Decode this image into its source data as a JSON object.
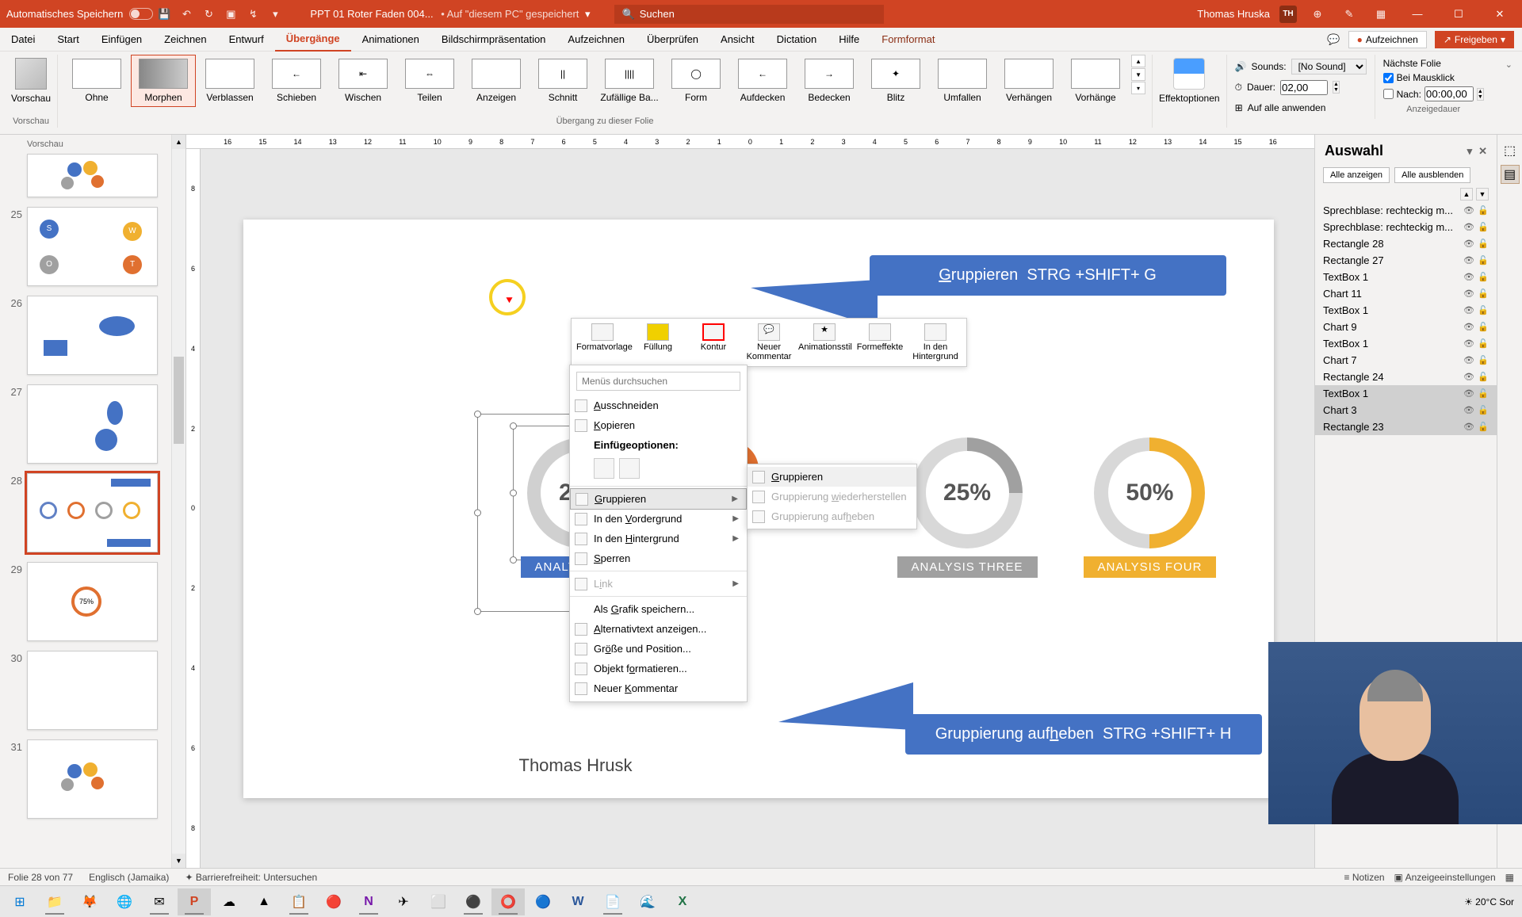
{
  "titlebar": {
    "autosave": "Automatisches Speichern",
    "doc_name": "PPT 01 Roter Faden 004...",
    "doc_location": "• Auf \"diesem PC\" gespeichert",
    "search_placeholder": "Suchen",
    "user_name": "Thomas Hruska",
    "user_initials": "TH"
  },
  "menubar": {
    "tabs": [
      "Datei",
      "Start",
      "Einfügen",
      "Zeichnen",
      "Entwurf",
      "Übergänge",
      "Animationen",
      "Bildschirmpräsentation",
      "Aufzeichnen",
      "Überprüfen",
      "Ansicht",
      "Dictation",
      "Hilfe",
      "Formformat"
    ],
    "active_index": 5,
    "record": "Aufzeichnen",
    "share": "Freigeben"
  },
  "ribbon": {
    "preview": "Vorschau",
    "transitions": [
      "Ohne",
      "Morphen",
      "Verblassen",
      "Schieben",
      "Wischen",
      "Teilen",
      "Anzeigen",
      "Schnitt",
      "Zufällige Ba...",
      "Form",
      "Aufdecken",
      "Bedecken",
      "Blitz",
      "Umfallen",
      "Verhängen",
      "Vorhänge"
    ],
    "selected_index": 1,
    "group_transition": "Übergang zu dieser Folie",
    "effect_options": "Effektoptionen",
    "sounds_label": "Sounds:",
    "sounds_value": "[No Sound]",
    "duration_label": "Dauer:",
    "duration_value": "02,00",
    "apply_all": "Auf alle anwenden",
    "next_slide": "Nächste Folie",
    "on_click": "Bei Mausklick",
    "after": "Nach:",
    "after_value": "00:00,00",
    "group_timing": "Anzeigedauer"
  },
  "thumbnails": {
    "preview_label": "Vorschau",
    "items": [
      {
        "num": "",
        "current": false
      },
      {
        "num": "25",
        "current": false
      },
      {
        "num": "26",
        "current": false
      },
      {
        "num": "27",
        "current": false
      },
      {
        "num": "28",
        "current": true
      },
      {
        "num": "29",
        "current": false
      },
      {
        "num": "30",
        "current": false
      },
      {
        "num": "31",
        "current": false
      }
    ]
  },
  "slide": {
    "callout_top": "Gruppieren  STRG +SHIFT+ G",
    "callout_top_u": "G",
    "callout_bottom": "Gruppierung aufheben  STRG +SHIFT+ H",
    "callout_bottom_u": "h",
    "donut1_val": "20%",
    "donut1_label": "ANALYSIS ONE",
    "donut3_val": "25%",
    "donut3_label": "ANALYSIS THREE",
    "donut4_val": "50%",
    "donut4_label": "ANALYSIS FOUR",
    "presenter": "Thomas Hrusk"
  },
  "mini_toolbar": [
    "Formatvorlage",
    "Füllung",
    "Kontur",
    "Neuer Kommentar",
    "Animationsstil",
    "Formeffekte",
    "In den Hintergrund"
  ],
  "context_menu": {
    "search_ph": "Menüs durchsuchen",
    "items": [
      {
        "label": "Ausschneiden",
        "u": "A",
        "icon": true
      },
      {
        "label": "Kopieren",
        "u": "K",
        "icon": true
      }
    ],
    "paste_label": "Einfügeoptionen:",
    "items2": [
      {
        "label": "Gruppieren",
        "u": "G",
        "arrow": true,
        "highlighted": true,
        "icon": true
      },
      {
        "label": "In den Vordergrund",
        "u": "V",
        "arrow": true,
        "icon": true
      },
      {
        "label": "In den Hintergrund",
        "u": "H",
        "arrow": true,
        "icon": true
      },
      {
        "label": "Sperren",
        "u": "S",
        "icon": true
      }
    ],
    "items3": [
      {
        "label": "Link",
        "u": "i",
        "arrow": true,
        "disabled": true,
        "icon": true
      }
    ],
    "items4": [
      {
        "label": "Als Grafik speichern...",
        "u": "G"
      },
      {
        "label": "Alternativtext anzeigen...",
        "u": "A",
        "icon": true
      },
      {
        "label": "Größe und Position...",
        "u": "ö",
        "icon": true
      },
      {
        "label": "Objekt formatieren...",
        "u": "o",
        "icon": true
      },
      {
        "label": "Neuer Kommentar",
        "u": "K",
        "icon": true
      }
    ]
  },
  "submenu": [
    {
      "label": "Gruppieren",
      "u": "G",
      "highlighted": true,
      "icon": true
    },
    {
      "label": "Gruppierung wiederherstellen",
      "u": "w",
      "disabled": true,
      "icon": true
    },
    {
      "label": "Gruppierung aufheben",
      "u": "h",
      "disabled": true,
      "icon": true
    }
  ],
  "selection_pane": {
    "title": "Auswahl",
    "show_all": "Alle anzeigen",
    "hide_all": "Alle ausblenden",
    "items": [
      {
        "name": "Sprechblase: rechteckig m...",
        "selected": false
      },
      {
        "name": "Sprechblase: rechteckig m...",
        "selected": false
      },
      {
        "name": "Rectangle 28",
        "selected": false
      },
      {
        "name": "Rectangle 27",
        "selected": false
      },
      {
        "name": "TextBox 1",
        "selected": false
      },
      {
        "name": "Chart 11",
        "selected": false
      },
      {
        "name": "TextBox 1",
        "selected": false
      },
      {
        "name": "Chart 9",
        "selected": false
      },
      {
        "name": "TextBox 1",
        "selected": false
      },
      {
        "name": "Chart 7",
        "selected": false
      },
      {
        "name": "Rectangle 24",
        "selected": false
      },
      {
        "name": "TextBox 1",
        "selected": true
      },
      {
        "name": "Chart 3",
        "selected": true
      },
      {
        "name": "Rectangle 23",
        "selected": true
      }
    ]
  },
  "statusbar": {
    "slide_info": "Folie 28 von 77",
    "language": "Englisch (Jamaika)",
    "accessibility": "Barrierefreiheit: Untersuchen",
    "notes": "Notizen",
    "display_settings": "Anzeigeeinstellungen"
  },
  "taskbar": {
    "weather": "20°C  Sor"
  },
  "chart_data": {
    "type": "pie",
    "series": [
      {
        "name": "ANALYSIS ONE",
        "value": 20,
        "color": "#6181c5"
      },
      {
        "name": "ANALYSIS THREE",
        "value": 25,
        "color": "#a0a0a0"
      },
      {
        "name": "ANALYSIS FOUR",
        "value": 50,
        "color": "#f0b030"
      }
    ],
    "unit": "%",
    "note": "Four donut infographics; donut 2 obscured by context menu (orange, ~75%)."
  }
}
